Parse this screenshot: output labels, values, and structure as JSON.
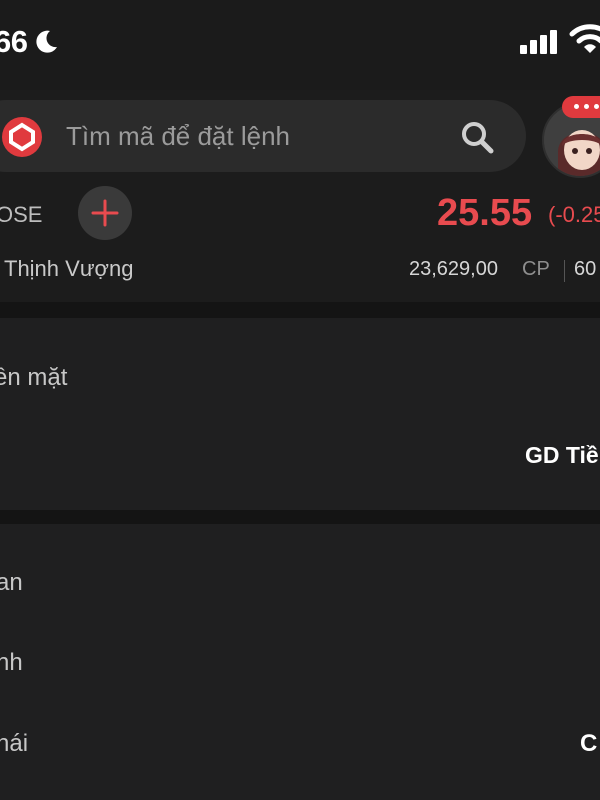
{
  "status_bar": {
    "time": "66",
    "icons": [
      "moon-icon",
      "signal-icon",
      "wifi-icon"
    ]
  },
  "search": {
    "placeholder": "Tìm mã để đặt lệnh",
    "logo_icon": "logo-icon",
    "search_icon": "search-icon"
  },
  "avatar": {
    "icon": "avatar-icon",
    "badge_icon": "chat-badge-icon"
  },
  "stock": {
    "exchange": "OSE",
    "company": "Thịnh Vượng",
    "price": "25.55",
    "change": "(-0.25",
    "volume": "23,629,00",
    "volume_unit": "CP",
    "value": "60"
  },
  "order_section": {
    "payment_label": "ền mặt",
    "row2_label": "",
    "trade_type": "GD Tiề"
  },
  "details_section": {
    "row1_label": "an",
    "row2_label": "nh",
    "row3_label": "hái",
    "row3_value": "C"
  },
  "colors": {
    "background": "#141414",
    "panel": "#1f1f20",
    "price_down": "#e84b4f",
    "brand": "#e03a3e"
  }
}
